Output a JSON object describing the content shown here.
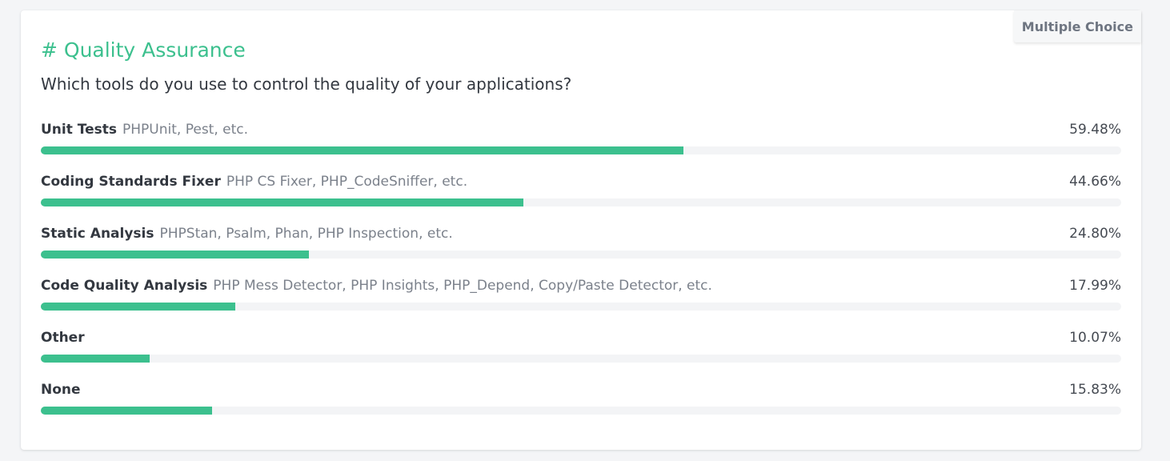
{
  "badge": "Multiple Choice",
  "title": "# Quality Assurance",
  "question": "Which tools do you use to control the quality of your applications?",
  "colors": {
    "accent": "#3cc08e",
    "track": "#f3f4f6"
  },
  "chart_data": {
    "type": "bar",
    "orientation": "horizontal",
    "categories": [
      "Unit Tests",
      "Coding Standards Fixer",
      "Static Analysis",
      "Code Quality Analysis",
      "Other",
      "None"
    ],
    "descriptions": [
      "PHPUnit, Pest, etc.",
      "PHP CS Fixer, PHP_CodeSniffer, etc.",
      "PHPStan, Psalm, Phan, PHP Inspection, etc.",
      "PHP Mess Detector, PHP Insights, PHP_Depend, Copy/Paste Detector, etc.",
      "",
      ""
    ],
    "values": [
      59.48,
      44.66,
      24.8,
      17.99,
      10.07,
      15.83
    ],
    "value_labels": [
      "59.48%",
      "44.66%",
      "24.80%",
      "17.99%",
      "10.07%",
      "15.83%"
    ],
    "xlim": [
      0,
      100
    ],
    "legend": "none",
    "grid": false
  }
}
